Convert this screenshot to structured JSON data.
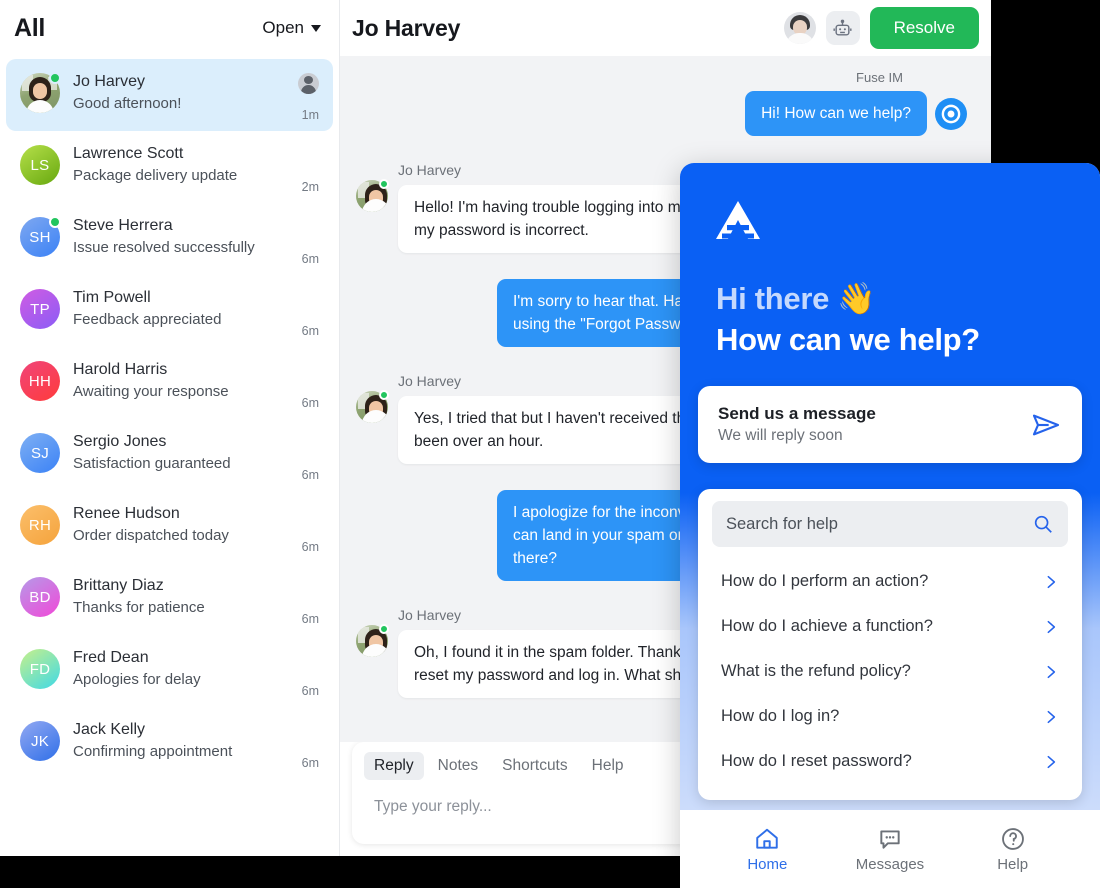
{
  "colors": {
    "accent_blue": "#2d94f7",
    "widget_blue": "#0a60f4",
    "resolve_green": "#22b858",
    "selected_row": "#dbeefc"
  },
  "list_panel": {
    "title": "All",
    "filter_label": "Open",
    "filter_icon": "chevron-down-icon",
    "threads": [
      {
        "name": "Jo Harvey",
        "preview": "Good afternoon!",
        "time": "1m",
        "initials": "",
        "avatar": "photo",
        "online": true,
        "selected": true,
        "assignee": true,
        "c1": "#cfd8c0",
        "c2": "#7d9463"
      },
      {
        "name": "Lawrence Scott",
        "preview": "Package delivery update",
        "time": "2m",
        "initials": "LS",
        "avatar": "mono",
        "online": false,
        "selected": false,
        "assignee": false,
        "c1": "#b6e04a",
        "c2": "#67a80f"
      },
      {
        "name": "Steve Herrera",
        "preview": "Issue resolved successfully",
        "time": "6m",
        "initials": "SH",
        "avatar": "mono",
        "online": true,
        "selected": false,
        "assignee": false,
        "c1": "#7fa8f0",
        "c2": "#3b82f6"
      },
      {
        "name": "Tim Powell",
        "preview": "Feedback appreciated",
        "time": "6m",
        "initials": "TP",
        "avatar": "mono",
        "online": false,
        "selected": false,
        "assignee": false,
        "c1": "#d05ce3",
        "c2": "#8b5cf6"
      },
      {
        "name": "Harold Harris",
        "preview": "Awaiting your response",
        "time": "6m",
        "initials": "HH",
        "avatar": "mono",
        "online": false,
        "selected": false,
        "assignee": false,
        "c1": "#f0457a",
        "c2": "#ff3b3b"
      },
      {
        "name": "Sergio Jones",
        "preview": "Satisfaction guaranteed",
        "time": "6m",
        "initials": "SJ",
        "avatar": "mono",
        "online": false,
        "selected": false,
        "assignee": false,
        "c1": "#7fb0f3",
        "c2": "#3b82f6"
      },
      {
        "name": "Renee Hudson",
        "preview": "Order dispatched today",
        "time": "6m",
        "initials": "RH",
        "avatar": "mono",
        "online": false,
        "selected": false,
        "assignee": false,
        "c1": "#fbbf6b",
        "c2": "#f5a33c"
      },
      {
        "name": "Brittany Diaz",
        "preview": "Thanks for patience",
        "time": "6m",
        "initials": "BD",
        "avatar": "mono",
        "online": false,
        "selected": false,
        "assignee": false,
        "c1": "#b59ae8",
        "c2": "#f148d8"
      },
      {
        "name": "Fred Dean",
        "preview": "Apologies for delay",
        "time": "6m",
        "initials": "FD",
        "avatar": "mono",
        "online": false,
        "selected": false,
        "assignee": false,
        "c1": "#c8f08a",
        "c2": "#3fd9e6"
      },
      {
        "name": "Jack Kelly",
        "preview": "Confirming appointment",
        "time": "6m",
        "initials": "JK",
        "avatar": "mono",
        "online": false,
        "selected": false,
        "assignee": false,
        "c1": "#93a9f2",
        "c2": "#2f6fe8"
      }
    ]
  },
  "conversation": {
    "title": "Jo Harvey",
    "agent_avatar_name": "agent-avatar",
    "bot_icon": "robot-icon",
    "resolve_label": "Resolve",
    "source_label": "Fuse IM",
    "messages": [
      {
        "dir": "out",
        "text": "Hi! How can we help?",
        "badge": true
      },
      {
        "dir": "in",
        "sender": "Jo Harvey",
        "text": "Hello! I'm having trouble logging into my account. It says my password is incorrect."
      },
      {
        "dir": "out",
        "text": "I'm sorry to hear that. Have you tried resetting your password using the \"Forgot Password\" link on the login page?"
      },
      {
        "dir": "in",
        "sender": "Jo Harvey",
        "text": "Yes, I tried that but I haven't received the reset email. It's been over an hour."
      },
      {
        "dir": "out",
        "text": "I apologize for the inconvenience. Sometimes the reset emails can land in your spam or junk folder. Could you please check there?"
      },
      {
        "dir": "in",
        "sender": "Jo Harvey",
        "text": "Oh, I found it in the spam folder. Thank you! I was able to reset my password and log in. What should I do?"
      }
    ],
    "composer": {
      "tabs": [
        {
          "label": "Reply",
          "active": true
        },
        {
          "label": "Notes",
          "active": false
        },
        {
          "label": "Shortcuts",
          "active": false
        },
        {
          "label": "Help",
          "active": false
        }
      ],
      "placeholder": "Type your reply..."
    }
  },
  "widget": {
    "logo_icon": "fuse-triangle-logo",
    "greeting_line1": "Hi there",
    "greeting_emoji": "👋",
    "greeting_line2": "How can we help?",
    "send_card": {
      "title": "Send us a message",
      "subtitle": "We will reply soon",
      "send_icon": "paper-plane-icon"
    },
    "help_card": {
      "search_placeholder": "Search for help",
      "search_icon": "search-icon",
      "questions": [
        "How do I perform an action?",
        "How do I achieve a function?",
        "What is the refund policy?",
        "How do I log in?",
        "How do I reset password?"
      ]
    },
    "nav": [
      {
        "label": "Home",
        "icon": "home-icon",
        "active": true
      },
      {
        "label": "Messages",
        "icon": "message-icon",
        "active": false
      },
      {
        "label": "Help",
        "icon": "question-icon",
        "active": false
      }
    ]
  }
}
